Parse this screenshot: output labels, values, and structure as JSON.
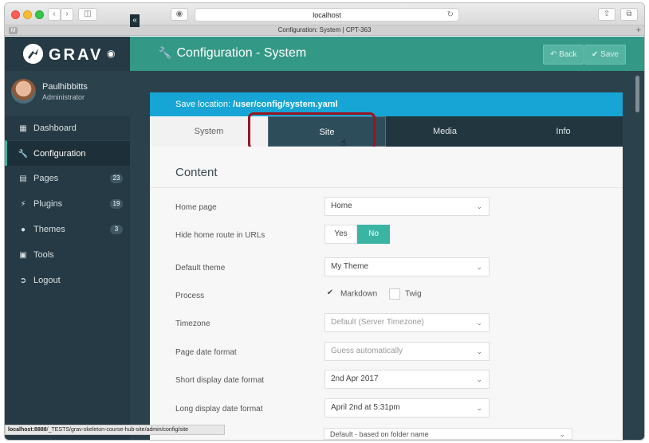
{
  "browser": {
    "address": "localhost",
    "tab_title": "Configuration: System | CPT-363",
    "favicon_letter": "M",
    "status_url_bold": "localhost:8888",
    "status_url_rest": "/_TESTS/grav-skeleton-course-hub-site/admin/config/site"
  },
  "sidebar": {
    "logo_text": "GRAV",
    "user": {
      "name": "Paulhibbitts",
      "role": "Administrator"
    },
    "items": [
      {
        "label": "Dashboard",
        "icon": "grid-icon",
        "count": ""
      },
      {
        "label": "Configuration",
        "icon": "wrench-icon",
        "count": ""
      },
      {
        "label": "Pages",
        "icon": "file-icon",
        "count": "23"
      },
      {
        "label": "Plugins",
        "icon": "plug-icon",
        "count": "19"
      },
      {
        "label": "Themes",
        "icon": "tint-icon",
        "count": "3"
      },
      {
        "label": "Tools",
        "icon": "briefcase-icon",
        "count": ""
      },
      {
        "label": "Logout",
        "icon": "sign-out-icon",
        "count": ""
      }
    ]
  },
  "header": {
    "title": "Configuration - System",
    "back_label": "Back",
    "save_label": "Save"
  },
  "config": {
    "save_location_prefix": "Save location:",
    "save_location_path": "/user/config/system.yaml",
    "tabs": [
      "System",
      "Site",
      "Media",
      "Info"
    ],
    "section_title": "Content",
    "fields": {
      "home_page": {
        "label": "Home page",
        "value": "Home"
      },
      "hide_home": {
        "label": "Hide home route in URLs",
        "yes": "Yes",
        "no": "No"
      },
      "default_theme": {
        "label": "Default theme",
        "value": "My Theme"
      },
      "process": {
        "label": "Process",
        "markdown": "Markdown",
        "twig": "Twig"
      },
      "timezone": {
        "label": "Timezone",
        "value": "Default (Server Timezone)"
      },
      "page_date_format": {
        "label": "Page date format",
        "value": "Guess automatically"
      },
      "short_date_format": {
        "label": "Short display date format",
        "value": "2nd Apr 2017"
      },
      "long_date_format": {
        "label": "Long display date format",
        "value": "April 2nd at 5:31pm"
      },
      "default_ordering": {
        "value": "Default - based on folder name"
      }
    }
  },
  "colors": {
    "sidebar": "#253a44",
    "header": "#349886",
    "accent": "#3ab5a4",
    "save_location_bar": "#16a5d4",
    "highlight": "#9a1420"
  }
}
